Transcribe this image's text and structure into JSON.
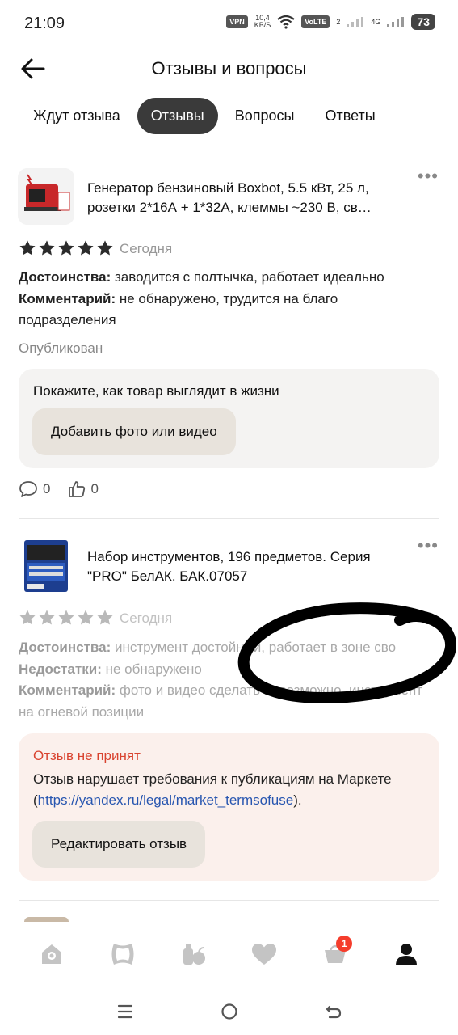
{
  "status_bar": {
    "time": "21:09",
    "vpn": "VPN",
    "speed_value": "10,4",
    "speed_unit": "KB/S",
    "volte": "VoLTE",
    "sim": "2",
    "network": "4G",
    "battery": "73"
  },
  "header": {
    "title": "Отзывы и вопросы"
  },
  "tabs": [
    {
      "label": "Ждут отзыва",
      "active": false
    },
    {
      "label": "Отзывы",
      "active": true
    },
    {
      "label": "Вопросы",
      "active": false
    },
    {
      "label": "Ответы",
      "active": false
    }
  ],
  "reviews": [
    {
      "product_title": "Генератор бензиновый Boxbot, 5.5 кВт, 25 л, розетки 2*16А + 1*32А, клеммы ~230 В, св…",
      "rating": 5,
      "date": "Сегодня",
      "pros_label": "Достоинства:",
      "pros": " заводится с полтычка, работает идеально",
      "comment_label": "Комментарий:",
      "comment": " не обнаружено, трудится на благо подразделения",
      "status": "Опубликован",
      "photo_prompt": "Покажите, как товар выглядит в жизни",
      "photo_button": "Добавить фото или видео",
      "comments_count": "0",
      "likes_count": "0"
    },
    {
      "product_title": "Набор инструментов, 196 предметов. Серия \"PRO\" БелАК. БАК.07057",
      "rating": 5,
      "date": "Сегодня",
      "pros_label": "Достоинства:",
      "pros": " инструмент достойный, работает в зоне сво",
      "cons_label": "Недостатки:",
      "cons": " не обнаружено",
      "comment_label": "Комментарий:",
      "comment": " фото и видео сделать невозможно, инструмент на огневой позиции",
      "rejected_title": "Отзыв не принят",
      "rejected_text_before": "Отзыв нарушает требования к публикациям на Маркете (",
      "rejected_link": "https://yandex.ru/legal/market_termsofuse",
      "rejected_text_after": ").",
      "edit_button": "Редактировать отзыв"
    }
  ],
  "bottom_nav": {
    "items": [
      "home-icon",
      "catalog-icon",
      "grocery-icon",
      "favorites-icon",
      "cart-icon",
      "profile-icon"
    ],
    "cart_badge": "1"
  },
  "colors": {
    "accent_dark": "#3a3a3a",
    "reject_red": "#d9432f",
    "link_blue": "#2856b0",
    "star": "#2b2b2b",
    "star_dim": "#b9b9b9"
  }
}
